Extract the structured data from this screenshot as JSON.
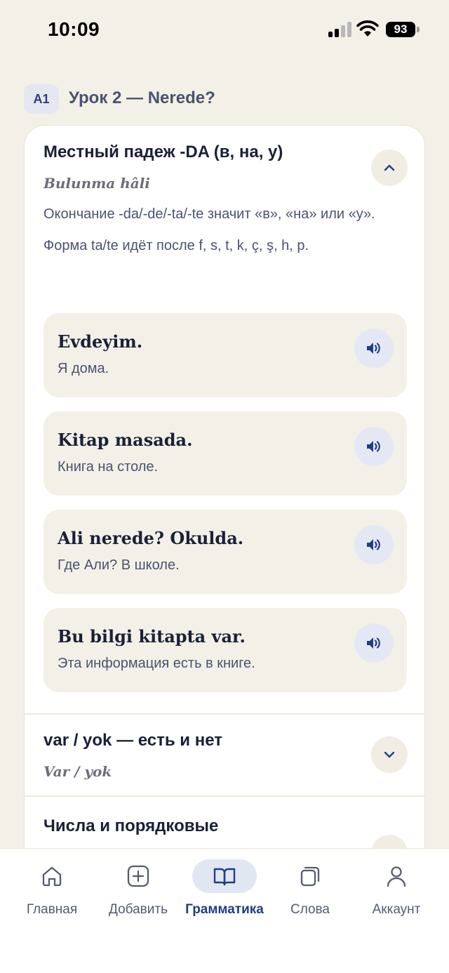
{
  "status_bar": {
    "time": "10:09",
    "battery": "93"
  },
  "lesson": {
    "level": "A1",
    "title": "Урок 2 — Nerede?"
  },
  "sections": [
    {
      "title": "Местный падеж -DA (в, на, у)",
      "subtitle": "Bulunma hâli",
      "expanded": true,
      "description": "Окончание -da/-de/-ta/-te значит «в», «на» или «у». Форма ta/te идёт после f, s, t, k, ç, ş, h, p.",
      "examples": [
        {
          "turkish": "Evdeyim.",
          "russian": "Я дома."
        },
        {
          "turkish": "Kitap masada.",
          "russian": "Книга на столе."
        },
        {
          "turkish": "Ali nerede? Okulda.",
          "russian": "Где Али? В школе."
        },
        {
          "turkish": "Bu bilgi kitapta var.",
          "russian": "Эта информация есть в книге."
        }
      ]
    },
    {
      "title": "var / yok — есть и нет",
      "subtitle": "Var / yok",
      "expanded": false
    },
    {
      "title": "Числа и порядковые числительные",
      "expanded": false
    }
  ],
  "tab_bar": {
    "active": "Грамматика",
    "tabs": [
      {
        "label": "Главная",
        "icon": "home-icon"
      },
      {
        "label": "Добавить",
        "icon": "plus-square-icon"
      },
      {
        "label": "Грамматика",
        "icon": "book-icon"
      },
      {
        "label": "Слова",
        "icon": "cards-icon"
      },
      {
        "label": "Аккаунт",
        "icon": "user-icon"
      }
    ]
  },
  "colors": {
    "background": "#f3f0e7",
    "card": "#ffffff",
    "accent": "#1f3e86",
    "example_bg": "#f3f0e7",
    "speak_btn": "#e4e8f4"
  }
}
